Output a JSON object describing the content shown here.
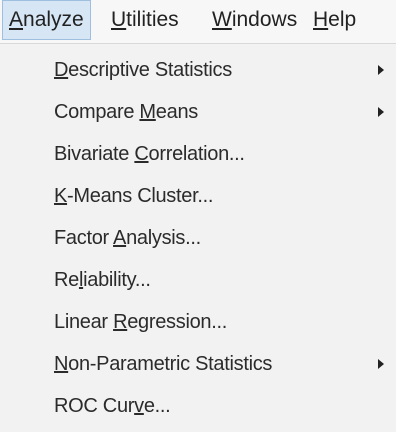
{
  "menubar": {
    "items": [
      {
        "pre": "",
        "key": "A",
        "post": "nalyze"
      },
      {
        "pre": "",
        "key": "U",
        "post": "tilities"
      },
      {
        "pre": "",
        "key": "W",
        "post": "indows"
      },
      {
        "pre": "",
        "key": "H",
        "post": "elp"
      }
    ]
  },
  "menu": {
    "items": [
      {
        "pre": "",
        "key": "D",
        "post": "escriptive Statistics",
        "submenu": true
      },
      {
        "pre": "Compare ",
        "key": "M",
        "post": "eans",
        "submenu": true
      },
      {
        "pre": "Bivariate ",
        "key": "C",
        "post": "orrelation...",
        "submenu": false
      },
      {
        "pre": "",
        "key": "K",
        "post": "-Means Cluster...",
        "submenu": false
      },
      {
        "pre": "Factor ",
        "key": "A",
        "post": "nalysis...",
        "submenu": false
      },
      {
        "pre": "Re",
        "key": "l",
        "post": "iability...",
        "submenu": false
      },
      {
        "pre": "Linear ",
        "key": "R",
        "post": "egression...",
        "submenu": false
      },
      {
        "pre": "",
        "key": "N",
        "post": "on-Parametric Statistics",
        "submenu": true
      },
      {
        "pre": "ROC Cur",
        "key": "v",
        "post": "e...",
        "submenu": false
      }
    ]
  }
}
